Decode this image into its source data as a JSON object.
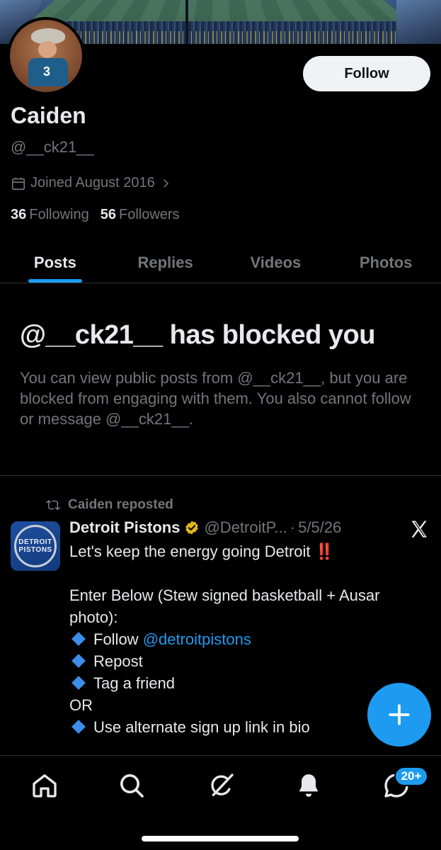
{
  "profile": {
    "display_name": "Caiden",
    "handle": "@__ck21__",
    "avatar_number": "3",
    "joined": "Joined August 2016",
    "following_count": "36",
    "following_label": "Following",
    "followers_count": "56",
    "followers_label": "Followers",
    "follow_label": "Follow"
  },
  "tabs": [
    {
      "label": "Posts",
      "active": true
    },
    {
      "label": "Replies",
      "active": false
    },
    {
      "label": "Videos",
      "active": false
    },
    {
      "label": "Photos",
      "active": false
    }
  ],
  "blocked": {
    "title": "@__ck21__ has blocked you",
    "message": "You can view public posts from @__ck21__, but you are blocked from engaging with them. You also cannot follow or message @__ck21__."
  },
  "post": {
    "repost_label": "Caiden reposted",
    "author_name": "Detroit Pistons",
    "author_handle": "@DetroitP...",
    "separator": "·",
    "date": "5/5/26",
    "avatar_text_1": "DETROIT",
    "avatar_text_2": "PISTONS",
    "lines": {
      "l1": "Let's keep the energy going Detroit",
      "l1_emoji": "‼️",
      "l2": "Enter Below (Stew signed basketball + Ausar",
      "l3": "photo):",
      "l4_prefix": "Follow ",
      "l4_link": "@detroitpistons",
      "l5": "Repost",
      "l6": "Tag a friend",
      "l7": "OR",
      "l8": "Use alternate sign up link in bio"
    }
  },
  "nav": {
    "messages_badge": "20+"
  },
  "colors": {
    "accent": "#1d9bf0",
    "muted": "#71767b",
    "text": "#e7e9ea",
    "background": "#000000",
    "verified_gold": "#e2b719"
  }
}
